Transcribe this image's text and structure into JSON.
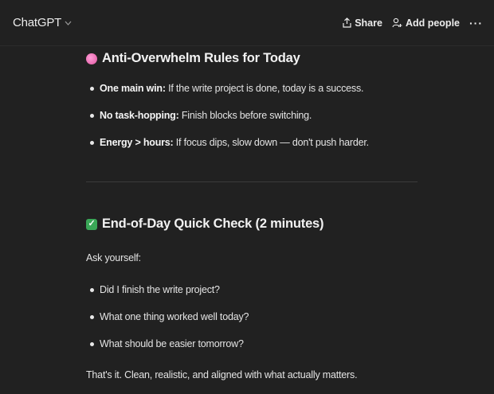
{
  "header": {
    "title": "ChatGPT",
    "title_chevron": "v",
    "share_label": "Share",
    "add_people_label": "Add people",
    "more_label": "···"
  },
  "section1": {
    "icon": "brain-icon",
    "heading": "Anti-Overwhelm Rules for Today",
    "items": [
      {
        "bold": "One main win:",
        "text": " If the write project is done, today is a success."
      },
      {
        "bold": "No task-hopping:",
        "text": " Finish blocks before switching."
      },
      {
        "bold": "Energy > hours:",
        "text": " If focus dips, slow down — don't push harder."
      }
    ]
  },
  "section2": {
    "icon": "check-mark-button-icon",
    "heading": "End-of-Day Quick Check (2 minutes)",
    "intro": "Ask yourself:",
    "items": [
      "Did I finish the write project?",
      "What one thing worked well today?",
      "What should be easier tomorrow?"
    ],
    "closing": "That's it. Clean, realistic, and aligned with what actually matters."
  },
  "colors": {
    "background": "#212121",
    "text": "#ececec",
    "divider": "#3c3c3c",
    "check_green": "#3aa757",
    "brain_pink": "#e0569f"
  }
}
